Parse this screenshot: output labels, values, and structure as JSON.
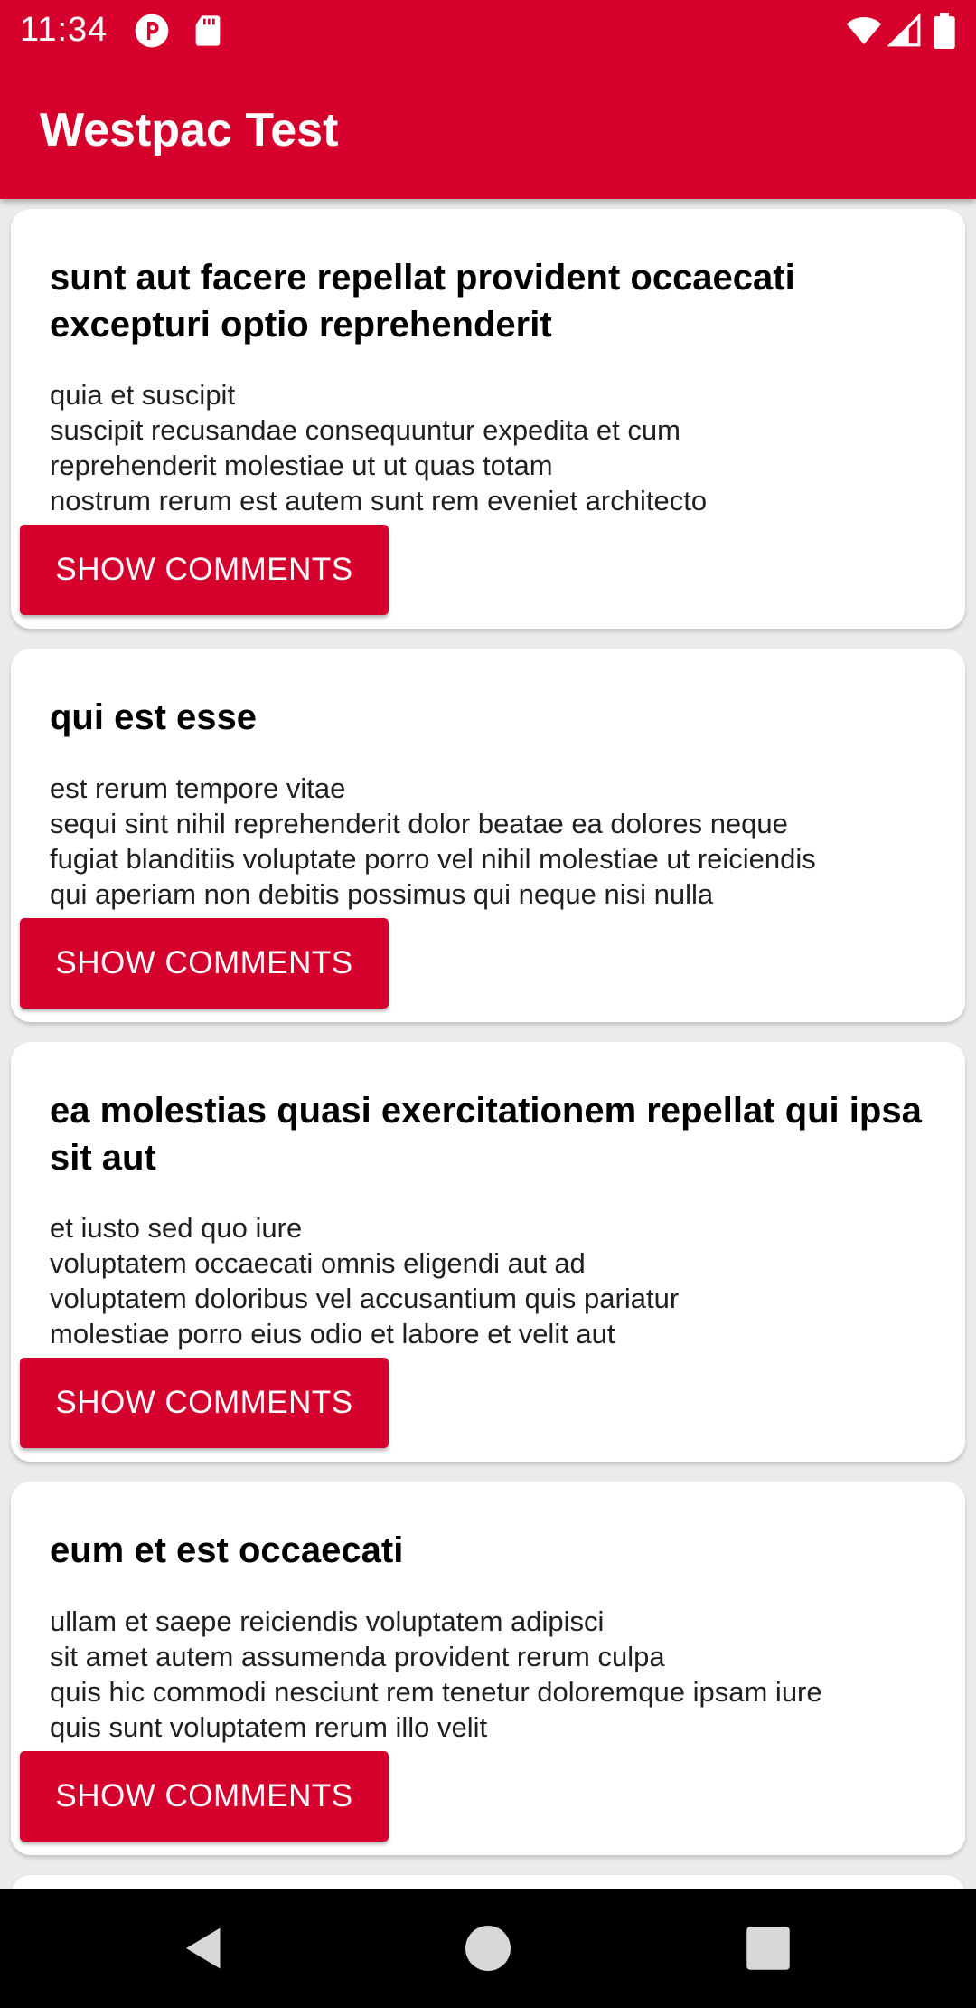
{
  "status_bar": {
    "time": "11:34",
    "icons": [
      "assistant-icon",
      "sd-card-icon",
      "wifi-icon",
      "cell-signal-icon",
      "battery-icon"
    ],
    "color": "#d5002b"
  },
  "app_bar": {
    "title": "Westpac Test",
    "color": "#d5002b"
  },
  "posts": [
    {
      "title": "sunt aut facere repellat provident occaecati\nexcepturi optio reprehenderit",
      "body": "quia et suscipit\nsuscipit recusandae consequuntur expedita et cum\nreprehenderit molestiae ut ut quas totam\nnostrum rerum est autem sunt rem eveniet architecto",
      "button_label": "SHOW COMMENTS"
    },
    {
      "title": "qui est esse",
      "body": "est rerum tempore vitae\nsequi sint nihil reprehenderit dolor beatae ea dolores neque\nfugiat blanditiis voluptate porro vel nihil molestiae ut reiciendis\nqui aperiam non debitis possimus qui neque nisi nulla",
      "button_label": "SHOW COMMENTS"
    },
    {
      "title": "ea molestias quasi exercitationem repellat qui ipsa\nsit aut",
      "body": "et iusto sed quo iure\nvoluptatem occaecati omnis eligendi aut ad\nvoluptatem doloribus vel accusantium quis pariatur\nmolestiae porro eius odio et labore et velit aut",
      "button_label": "SHOW COMMENTS"
    },
    {
      "title": "eum et est occaecati",
      "body": "ullam et saepe reiciendis voluptatem adipisci\nsit amet autem assumenda provident rerum culpa\nquis hic commodi nesciunt rem tenetur doloremque ipsam iure\nquis sunt voluptatem rerum illo velit",
      "button_label": "SHOW COMMENTS"
    }
  ],
  "nav_bar": {
    "buttons": [
      "back-icon",
      "home-icon",
      "recents-icon"
    ]
  }
}
